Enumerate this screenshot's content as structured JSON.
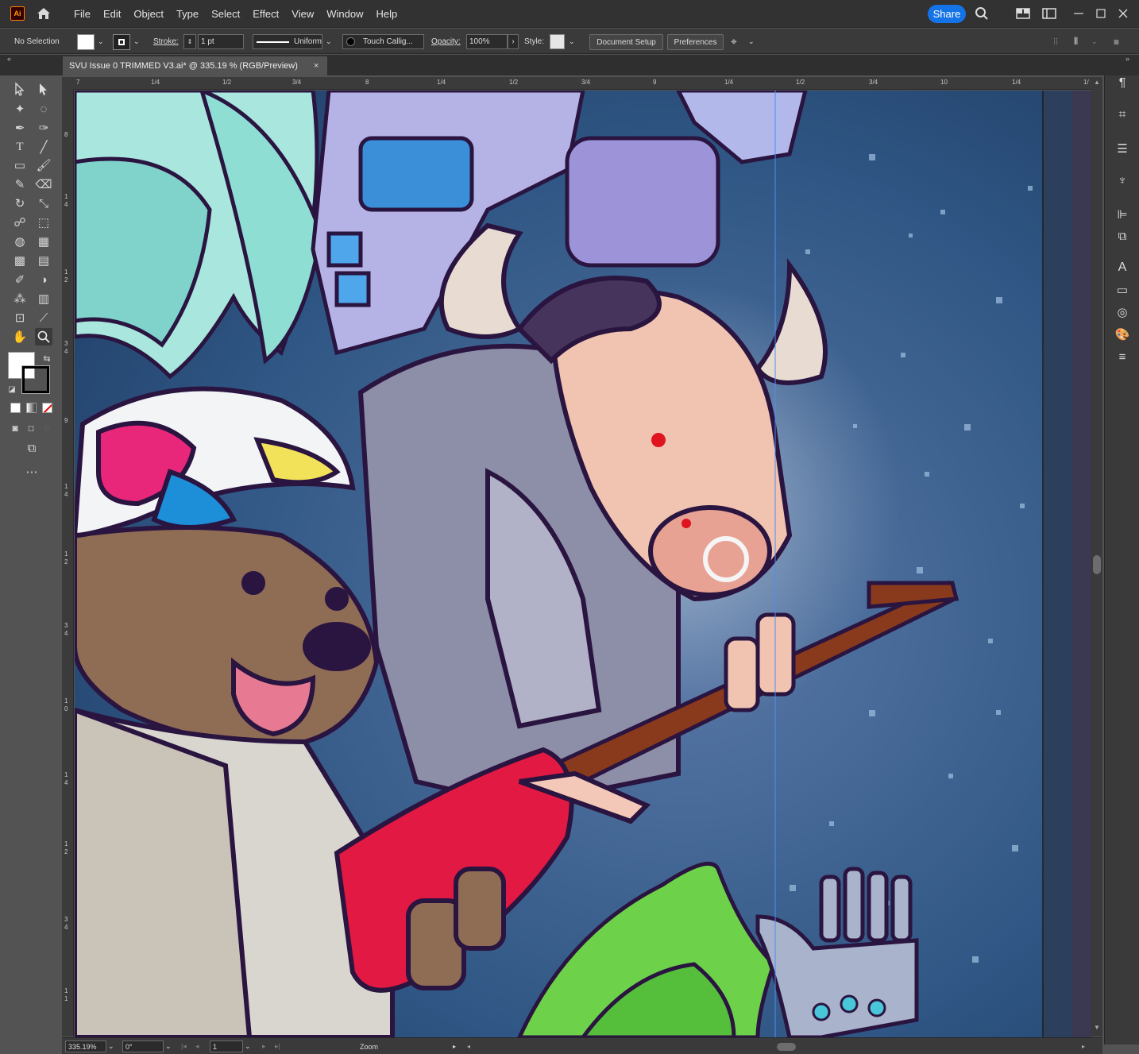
{
  "app": {
    "logo": "Ai",
    "share_label": "Share"
  },
  "menu": [
    "File",
    "Edit",
    "Object",
    "Type",
    "Select",
    "Effect",
    "View",
    "Window",
    "Help"
  ],
  "control": {
    "selection": "No Selection",
    "stroke_label": "Stroke:",
    "stroke_value": "1 pt",
    "profile": "Uniform",
    "brush": "Touch Callig...",
    "opacity_label": "Opacity:",
    "opacity_value": "100%",
    "style_label": "Style:",
    "document_setup": "Document Setup",
    "preferences": "Preferences"
  },
  "document": {
    "tab_title": "SVU Issue 0 TRIMMED V3.ai* @ 335.19 % (RGB/Preview)",
    "close": "×"
  },
  "ruler": {
    "top": [
      "7",
      "1/4",
      "1/2",
      "3/4",
      "8",
      "1/4",
      "1/2",
      "3/4",
      "9",
      "1/4",
      "1/2",
      "3/4",
      "10",
      "1/4",
      "1/"
    ],
    "left": [
      "8",
      "1",
      "4",
      "1",
      "2",
      "3",
      "4",
      "9",
      "1",
      "4",
      "1",
      "2",
      "3",
      "4",
      "1",
      "0",
      "1",
      "4",
      "1",
      "2",
      "3",
      "4",
      "1",
      "1"
    ]
  },
  "status": {
    "zoom": "335.19%",
    "rotation": "0°",
    "artboard": "1",
    "tool": "Zoom"
  },
  "colors": {
    "accent": "#1473e6",
    "panel": "#535353",
    "dark": "#323232"
  },
  "icons": [
    "home-icon",
    "search-icon",
    "arrange-icon",
    "panel-icon",
    "minimize-icon",
    "maximize-icon",
    "close-icon"
  ]
}
